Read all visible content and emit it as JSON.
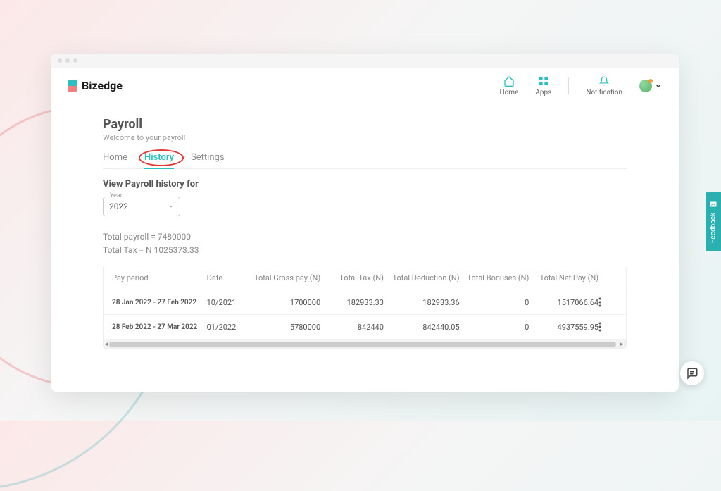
{
  "brand": "Bizedge",
  "header": {
    "home": "Home",
    "apps": "Apps",
    "notification": "Notification"
  },
  "page": {
    "title": "Payroll",
    "subtitle": "Welcome to your payroll"
  },
  "tabs": {
    "home": "Home",
    "history": "History",
    "settings": "Settings"
  },
  "section": {
    "label": "View Payroll history for",
    "year_label": "Year",
    "year_value": "2022"
  },
  "totals": {
    "payroll": "Total payroll = 7480000",
    "tax": "Total Tax = N 1025373.33"
  },
  "columns": {
    "period": "Pay period",
    "date": "Date",
    "gross": "Total Gross pay (N)",
    "tax": "Total Tax (N)",
    "deduction": "Total Deduction (N)",
    "bonuses": "Total Bonuses (N)",
    "netpay": "Total Net Pay (N)"
  },
  "rows": [
    {
      "period": "28 Jan 2022 - 27 Feb 2022",
      "date": "10/2021",
      "gross": "1700000",
      "tax": "182933.33",
      "deduction": "182933.36",
      "bonuses": "0",
      "netpay": "1517066.64"
    },
    {
      "period": "28 Feb 2022 - 27 Mar 2022",
      "date": "01/2022",
      "gross": "5780000",
      "tax": "842440",
      "deduction": "842440.05",
      "bonuses": "0",
      "netpay": "4937559.95"
    }
  ],
  "feedback": "Feedback"
}
